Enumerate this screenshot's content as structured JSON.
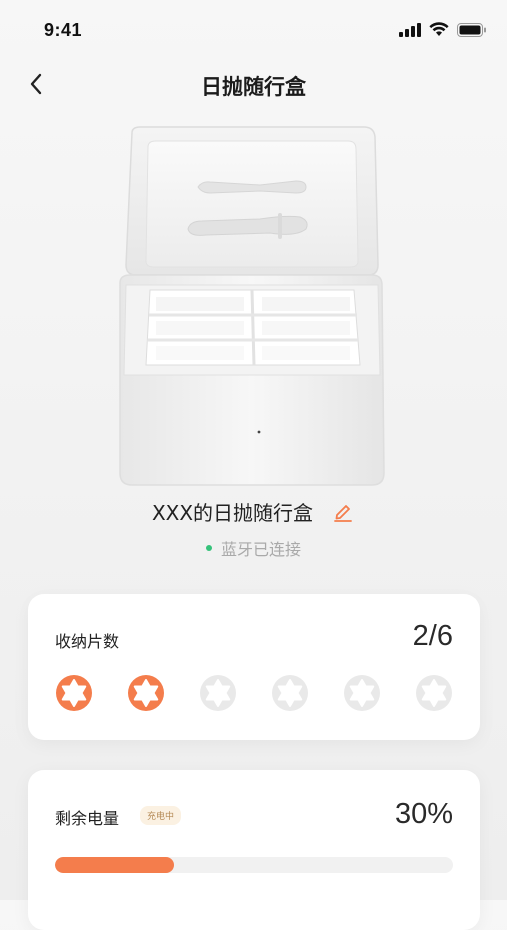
{
  "status_bar": {
    "time": "9:41"
  },
  "nav": {
    "title": "日抛随行盒",
    "back_icon": "chevron-left-icon"
  },
  "device": {
    "image": "lens-case-open-product-image",
    "name": "XXX的日抛随行盒",
    "edit_icon": "pencil-icon",
    "connection_status": "蓝牙已连接",
    "connection_color": "#35c27a"
  },
  "storage": {
    "label": "收纳片数",
    "value": "2/6",
    "filled": 2,
    "total": 6,
    "filled_color": "#f47d4c",
    "empty_color": "#e9e9e9"
  },
  "battery": {
    "label": "剩余电量",
    "badge": "充电中",
    "value": "30%",
    "level": 0.3,
    "fill_color": "#f47d4c"
  }
}
